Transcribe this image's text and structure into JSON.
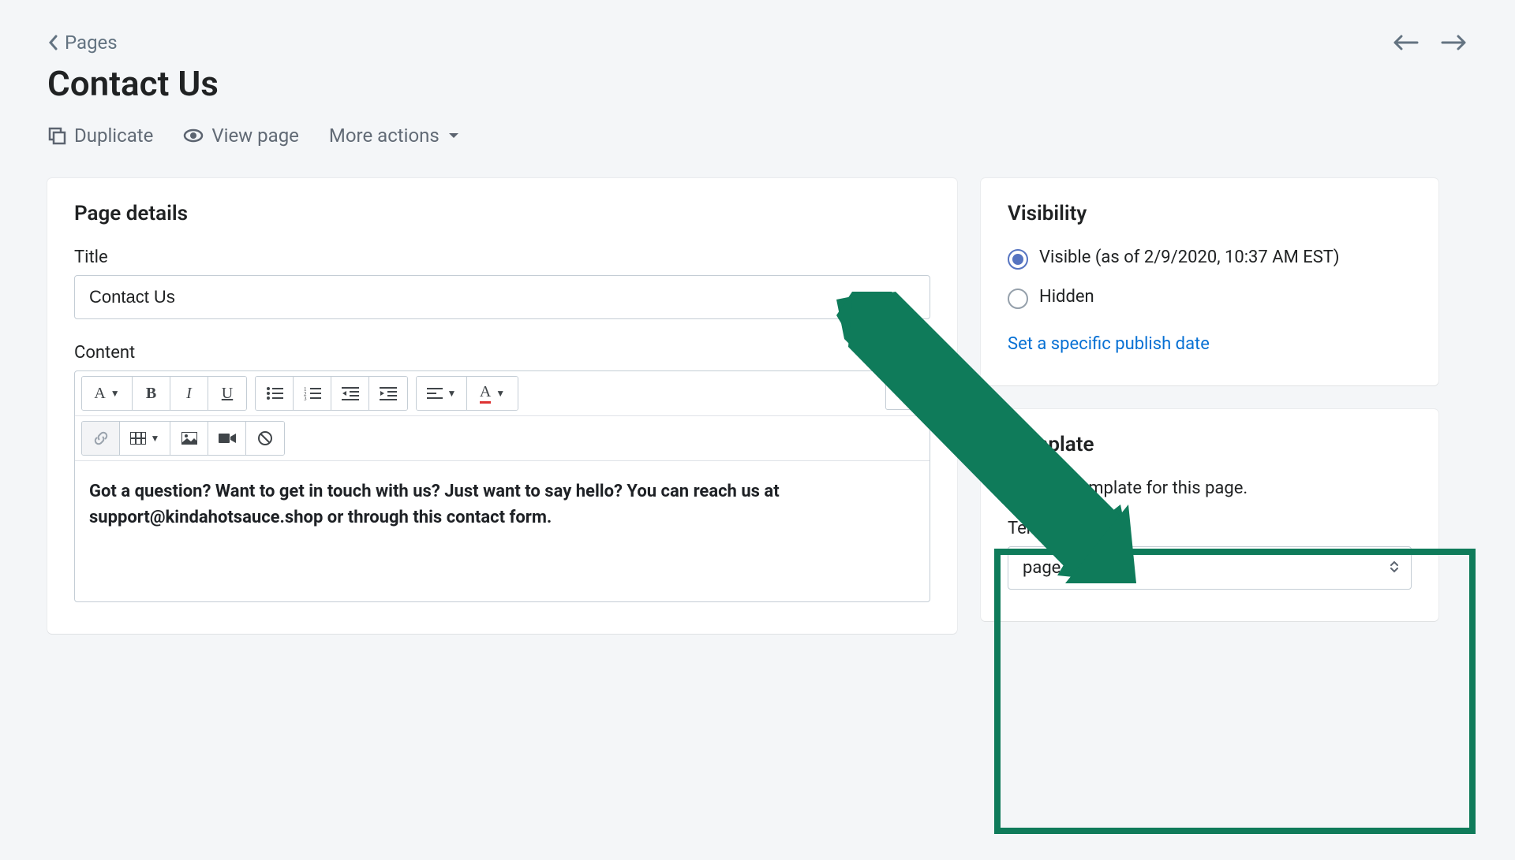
{
  "breadcrumb": {
    "label": "Pages"
  },
  "page_title": "Contact Us",
  "actions": {
    "duplicate": "Duplicate",
    "view_page": "View page",
    "more_actions": "More actions"
  },
  "page_details": {
    "heading": "Page details",
    "title_label": "Title",
    "title_value": "Contact Us",
    "content_label": "Content",
    "editor_text": "Got a question? Want to get in touch with us? Just want to say hello? You can reach us at support@kindahotsauce.shop or through this contact form."
  },
  "visibility": {
    "heading": "Visibility",
    "visible_label": "Visible (as of 2/9/2020, 10:37 AM EST)",
    "hidden_label": "Hidden",
    "set_date_link": "Set a specific publish date"
  },
  "template": {
    "heading": "Template",
    "description": "Select a template for this page.",
    "suffix_label": "Template suffix",
    "suffix_value": "page.contact"
  }
}
